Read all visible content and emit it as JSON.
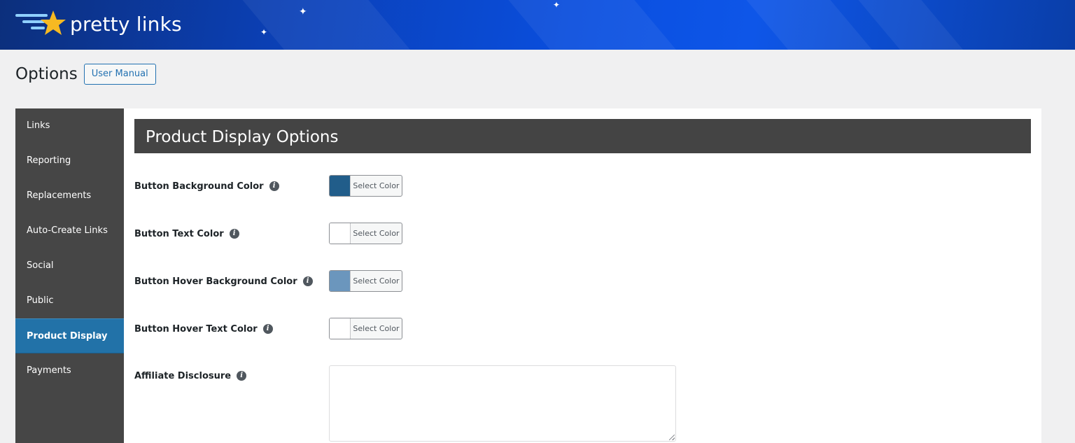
{
  "brand": {
    "name": "pretty links",
    "star_color": "#f6b922",
    "wing_color": "#8fd0ff"
  },
  "page": {
    "title": "Options",
    "manual_button": "User Manual"
  },
  "sidebar": {
    "items": [
      {
        "label": "Links",
        "active": false
      },
      {
        "label": "Reporting",
        "active": false
      },
      {
        "label": "Replacements",
        "active": false
      },
      {
        "label": "Auto-Create Links",
        "active": false
      },
      {
        "label": "Social",
        "active": false
      },
      {
        "label": "Public",
        "active": false
      },
      {
        "label": "Product Display",
        "active": true
      },
      {
        "label": "Payments",
        "active": false
      }
    ]
  },
  "section": {
    "title": "Product Display Options"
  },
  "options": [
    {
      "label": "Button Background Color",
      "picker_label": "Select Color",
      "color": "#215d8a"
    },
    {
      "label": "Button Text Color",
      "picker_label": "Select Color",
      "color": "#ffffff"
    },
    {
      "label": "Button Hover Background Color",
      "picker_label": "Select Color",
      "color": "#6b96bd"
    },
    {
      "label": "Button Hover Text Color",
      "picker_label": "Select Color",
      "color": "#ffffff"
    }
  ],
  "disclosure": {
    "label": "Affiliate Disclosure",
    "value": ""
  },
  "icons": {
    "info": "info-icon",
    "sparkle": "sparkle-icon"
  }
}
